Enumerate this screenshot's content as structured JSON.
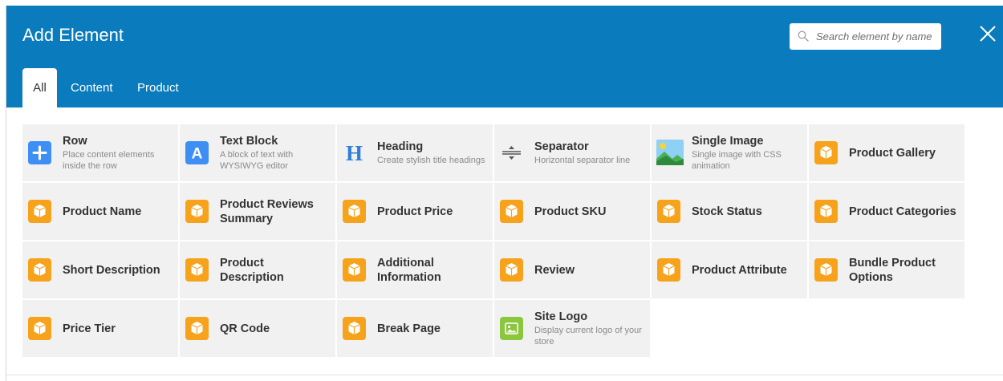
{
  "header": {
    "title": "Add Element",
    "search_placeholder": "Search element by name",
    "bg_color": "#0a7bbd"
  },
  "tabs": [
    {
      "label": "All",
      "active": true
    },
    {
      "label": "Content",
      "active": false
    },
    {
      "label": "Product",
      "active": false
    }
  ],
  "elements": [
    {
      "name": "Row",
      "desc": "Place content elements inside the row",
      "icon": "plus-icon",
      "icon_color": "#3d8ff4"
    },
    {
      "name": "Text Block",
      "desc": "A block of text with WYSIWYG editor",
      "icon": "letter-a-icon",
      "icon_color": "#3d8ff4"
    },
    {
      "name": "Heading",
      "desc": "Create stylish title headings",
      "icon": "letter-h-icon",
      "icon_color": "#2f7fd9"
    },
    {
      "name": "Separator",
      "desc": "Horizontal separator line",
      "icon": "separator-icon",
      "icon_color": "#555555"
    },
    {
      "name": "Single Image",
      "desc": "Single image with CSS animation",
      "icon": "landscape-image-icon",
      "icon_color": "#6fb7e8"
    },
    {
      "name": "Product Gallery",
      "desc": "",
      "icon": "box-icon",
      "icon_color": "#f7a21b"
    },
    {
      "name": "Product Name",
      "desc": "",
      "icon": "box-icon",
      "icon_color": "#f7a21b"
    },
    {
      "name": "Product Reviews Summary",
      "desc": "",
      "icon": "box-icon",
      "icon_color": "#f7a21b"
    },
    {
      "name": "Product Price",
      "desc": "",
      "icon": "box-icon",
      "icon_color": "#f7a21b"
    },
    {
      "name": "Product SKU",
      "desc": "",
      "icon": "box-icon",
      "icon_color": "#f7a21b"
    },
    {
      "name": "Stock Status",
      "desc": "",
      "icon": "box-icon",
      "icon_color": "#f7a21b"
    },
    {
      "name": "Product Categories",
      "desc": "",
      "icon": "box-icon",
      "icon_color": "#f7a21b"
    },
    {
      "name": "Short Description",
      "desc": "",
      "icon": "box-icon",
      "icon_color": "#f7a21b"
    },
    {
      "name": "Product Description",
      "desc": "",
      "icon": "box-icon",
      "icon_color": "#f7a21b"
    },
    {
      "name": "Additional Information",
      "desc": "",
      "icon": "box-icon",
      "icon_color": "#f7a21b"
    },
    {
      "name": "Review",
      "desc": "",
      "icon": "box-icon",
      "icon_color": "#f7a21b"
    },
    {
      "name": "Product Attribute",
      "desc": "",
      "icon": "box-icon",
      "icon_color": "#f7a21b"
    },
    {
      "name": "Bundle Product Options",
      "desc": "",
      "icon": "box-icon",
      "icon_color": "#f7a21b"
    },
    {
      "name": "Price Tier",
      "desc": "",
      "icon": "box-icon",
      "icon_color": "#f7a21b"
    },
    {
      "name": "QR Code",
      "desc": "",
      "icon": "box-icon",
      "icon_color": "#f7a21b"
    },
    {
      "name": "Break Page",
      "desc": "",
      "icon": "box-icon",
      "icon_color": "#f7a21b"
    },
    {
      "name": "Site Logo",
      "desc": "Display current logo of your store",
      "icon": "logo-image-icon",
      "icon_color": "#8cc63f"
    }
  ]
}
